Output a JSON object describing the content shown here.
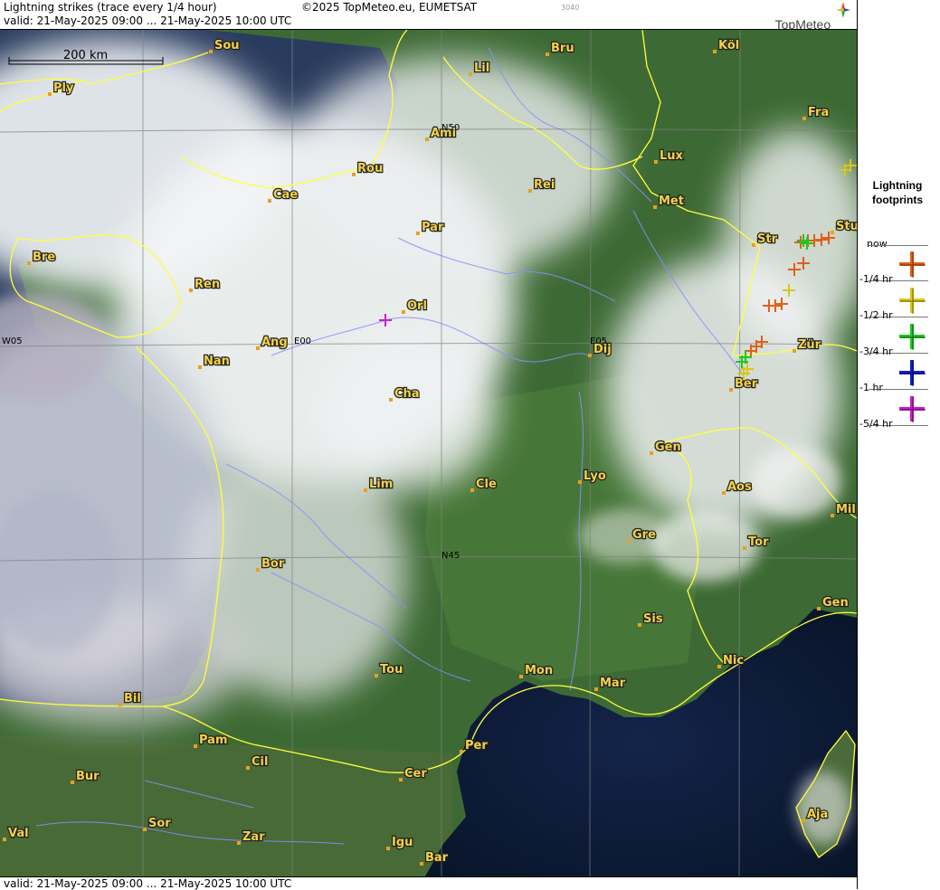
{
  "header": {
    "title": "Lightning strikes (trace every 1/4 hour)",
    "copyright": "©2025 TopMeteo.eu, EUMETSAT",
    "code": "3040",
    "valid": "valid:  21-May-2025 09:00 ... 21-May-2025 10:00 UTC",
    "brand": "TopMeteo"
  },
  "footer": {
    "valid": "valid:  21-May-2025 09:00 ... 21-May-2025 10:00 UTC"
  },
  "map": {
    "scale_label": "200 km",
    "grid_labels": [
      "N50",
      "N45",
      "W05",
      "E00",
      "E05"
    ],
    "cities": [
      "Sou",
      "Bru",
      "Köl",
      "Lil",
      "Ply",
      "Ami",
      "Fra",
      "Lux",
      "Rou",
      "Cae",
      "Rei",
      "Met",
      "Par",
      "Stu",
      "Str",
      "Bre",
      "Ren",
      "Orl",
      "Ang",
      "Nan",
      "Dij",
      "Zür",
      "Ber",
      "Cha",
      "Gen",
      "Lim",
      "Cle",
      "Lyo",
      "Aos",
      "Mil",
      "Gre",
      "Tor",
      "Bor",
      "Sis",
      "Gen",
      "Tou",
      "Mon",
      "Mar",
      "Nic",
      "Bil",
      "Pam",
      "Cil",
      "Per",
      "Cer",
      "Bur",
      "Sor",
      "Val",
      "Zar",
      "Igu",
      "Aja",
      "Bar"
    ]
  },
  "legend": {
    "title_line1": "Lightning",
    "title_line2": "footprints",
    "items": [
      {
        "label": "now",
        "color": "#e0601a"
      },
      {
        "label": "-1/4 hr",
        "color": "#d8c81a"
      },
      {
        "label": "-1/2 hr",
        "color": "#1ec81e"
      },
      {
        "label": "-3/4 hr",
        "color": "#1020c8"
      },
      {
        "label": "-1 hr",
        "color": "#c820c8"
      },
      {
        "label": "-5/4 hr",
        "color": ""
      }
    ]
  },
  "colors": {
    "border": "#ffff3c",
    "rivers": "#8c8cff",
    "grid": "#808080",
    "sea": "#0c1830"
  }
}
